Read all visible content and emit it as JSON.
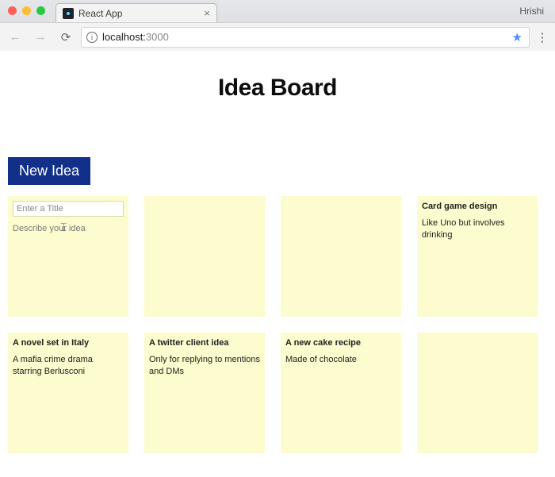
{
  "browser": {
    "profile_name": "Hrishi",
    "tab_title": "React App",
    "url_host": "localhost:",
    "url_port": "3000"
  },
  "app": {
    "title": "Idea Board",
    "new_button_label": "New Idea",
    "title_placeholder": "Enter a Title",
    "desc_placeholder": "Describe your idea"
  },
  "cards": {
    "0": {
      "title": "Card game design",
      "body": "Like Uno but involves drinking"
    },
    "1": {
      "title": "A novel set in Italy",
      "body": "A mafia crime drama starring Berlusconi"
    },
    "2": {
      "title": "A twitter client idea",
      "body": "Only for replying to mentions and DMs"
    },
    "3": {
      "title": "A new cake recipe",
      "body": "Made of chocolate"
    }
  }
}
